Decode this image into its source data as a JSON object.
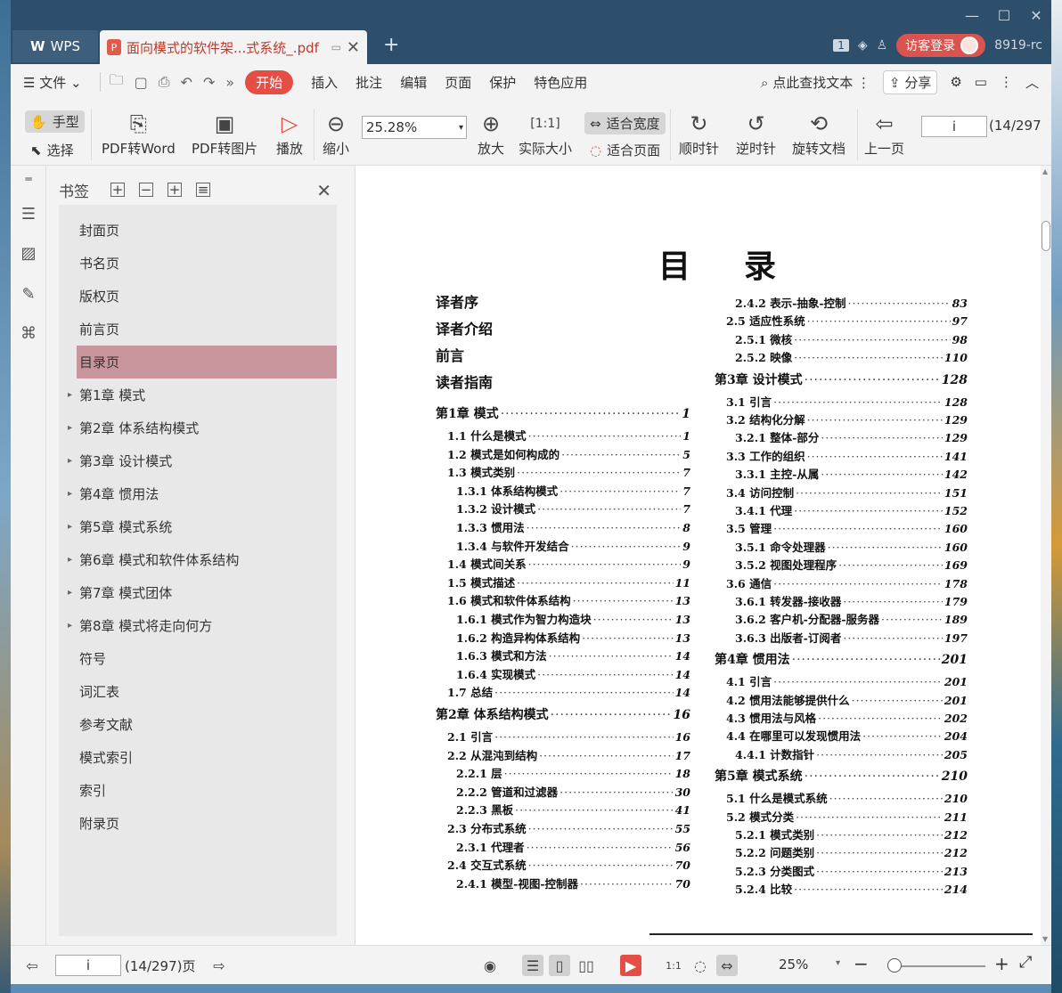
{
  "titlebar": {
    "wps_tab": "WPS",
    "doc_tab": "面向模式的软件架...式系统_.pdf",
    "user_button": "访客登录",
    "user_id": "8919-rc",
    "badge": "1"
  },
  "menubar": {
    "file": "文件",
    "items": [
      "开始",
      "插入",
      "批注",
      "编辑",
      "页面",
      "保护",
      "特色应用"
    ],
    "search": "点此查找文本",
    "share": "分享"
  },
  "ribbon": {
    "hand": "手型",
    "select": "选择",
    "pdf_word": "PDF转Word",
    "pdf_image": "PDF转图片",
    "play": "播放",
    "zoom_out": "缩小",
    "zoom_value": "25.28%",
    "zoom_in": "放大",
    "actual_size": "实际大小",
    "fit_width": "适合宽度",
    "fit_page": "适合页面",
    "clockwise": "顺时针",
    "counterclockwise": "逆时针",
    "rotate_doc": "旋转文档",
    "prev_page": "上一页",
    "page_value": "i",
    "page_total": "(14/297"
  },
  "bookmarks": {
    "title": "书签",
    "items": [
      {
        "label": "封面页",
        "expandable": false
      },
      {
        "label": "书名页",
        "expandable": false
      },
      {
        "label": "版权页",
        "expandable": false
      },
      {
        "label": "前言页",
        "expandable": false
      },
      {
        "label": "目录页",
        "expandable": false,
        "selected": true
      },
      {
        "label": "第1章  模式",
        "expandable": true
      },
      {
        "label": "第2章  体系结构模式",
        "expandable": true
      },
      {
        "label": "第3章  设计模式",
        "expandable": true
      },
      {
        "label": "第4章  惯用法",
        "expandable": true
      },
      {
        "label": "第5章  模式系统",
        "expandable": true
      },
      {
        "label": "第6章  模式和软件体系结构",
        "expandable": true
      },
      {
        "label": "第7章  模式团体",
        "expandable": true
      },
      {
        "label": "第8章  模式将走向何方",
        "expandable": true
      },
      {
        "label": "符号",
        "expandable": false
      },
      {
        "label": "词汇表",
        "expandable": false
      },
      {
        "label": "参考文献",
        "expandable": false
      },
      {
        "label": "模式索引",
        "expandable": false
      },
      {
        "label": "索引",
        "expandable": false
      },
      {
        "label": "附录页",
        "expandable": false
      }
    ]
  },
  "document": {
    "heading": "目录",
    "front_matter": [
      "译者序",
      "译者介绍",
      "前言",
      "读者指南"
    ],
    "left_column": [
      {
        "t": "第1章  模式",
        "p": "1",
        "level": 0
      },
      {
        "t": "1.1  什么是模式",
        "p": "1",
        "level": 1
      },
      {
        "t": "1.2  模式是如何构成的",
        "p": "5",
        "level": 1
      },
      {
        "t": "1.3  模式类别",
        "p": "7",
        "level": 1
      },
      {
        "t": "1.3.1  体系结构模式",
        "p": "7",
        "level": 2
      },
      {
        "t": "1.3.2  设计模式",
        "p": "7",
        "level": 2
      },
      {
        "t": "1.3.3  惯用法",
        "p": "8",
        "level": 2
      },
      {
        "t": "1.3.4  与软件开发结合",
        "p": "9",
        "level": 2
      },
      {
        "t": "1.4  模式间关系",
        "p": "9",
        "level": 1
      },
      {
        "t": "1.5  模式描述",
        "p": "11",
        "level": 1
      },
      {
        "t": "1.6  模式和软件体系结构",
        "p": "13",
        "level": 1
      },
      {
        "t": "1.6.1  模式作为智力构造块",
        "p": "13",
        "level": 2
      },
      {
        "t": "1.6.2  构造异构体系结构",
        "p": "13",
        "level": 2
      },
      {
        "t": "1.6.3  模式和方法",
        "p": "14",
        "level": 2
      },
      {
        "t": "1.6.4  实现模式",
        "p": "14",
        "level": 2
      },
      {
        "t": "1.7  总结",
        "p": "14",
        "level": 1
      },
      {
        "t": "第2章  体系结构模式",
        "p": "16",
        "level": 0
      },
      {
        "t": "2.1  引言",
        "p": "16",
        "level": 1
      },
      {
        "t": "2.2  从混沌到结构",
        "p": "17",
        "level": 1
      },
      {
        "t": "2.2.1  层",
        "p": "18",
        "level": 2
      },
      {
        "t": "2.2.2  管道和过滤器",
        "p": "30",
        "level": 2
      },
      {
        "t": "2.2.3  黑板",
        "p": "41",
        "level": 2
      },
      {
        "t": "2.3  分布式系统",
        "p": "55",
        "level": 1
      },
      {
        "t": "2.3.1  代理者",
        "p": "56",
        "level": 2
      },
      {
        "t": "2.4  交互式系统",
        "p": "70",
        "level": 1
      },
      {
        "t": "2.4.1  模型-视图-控制器",
        "p": "70",
        "level": 2
      }
    ],
    "right_column": [
      {
        "t": "2.4.2  表示-抽象-控制",
        "p": "83",
        "level": 2
      },
      {
        "t": "2.5  适应性系统",
        "p": "97",
        "level": 1
      },
      {
        "t": "2.5.1  微核",
        "p": "98",
        "level": 2
      },
      {
        "t": "2.5.2  映像",
        "p": "110",
        "level": 2
      },
      {
        "t": "第3章  设计模式",
        "p": "128",
        "level": 0
      },
      {
        "t": "3.1  引言",
        "p": "128",
        "level": 1
      },
      {
        "t": "3.2  结构化分解",
        "p": "129",
        "level": 1
      },
      {
        "t": "3.2.1  整体-部分",
        "p": "129",
        "level": 2
      },
      {
        "t": "3.3  工作的组织",
        "p": "141",
        "level": 1
      },
      {
        "t": "3.3.1  主控-从属",
        "p": "142",
        "level": 2
      },
      {
        "t": "3.4  访问控制",
        "p": "151",
        "level": 1
      },
      {
        "t": "3.4.1  代理",
        "p": "152",
        "level": 2
      },
      {
        "t": "3.5  管理",
        "p": "160",
        "level": 1
      },
      {
        "t": "3.5.1  命令处理器",
        "p": "160",
        "level": 2
      },
      {
        "t": "3.5.2  视图处理程序",
        "p": "169",
        "level": 2
      },
      {
        "t": "3.6  通信",
        "p": "178",
        "level": 1
      },
      {
        "t": "3.6.1  转发器-接收器",
        "p": "179",
        "level": 2
      },
      {
        "t": "3.6.2  客户机-分配器-服务器",
        "p": "189",
        "level": 2
      },
      {
        "t": "3.6.3  出版者-订阅者",
        "p": "197",
        "level": 2
      },
      {
        "t": "第4章  惯用法",
        "p": "201",
        "level": 0
      },
      {
        "t": "4.1  引言",
        "p": "201",
        "level": 1
      },
      {
        "t": "4.2  惯用法能够提供什么",
        "p": "201",
        "level": 1
      },
      {
        "t": "4.3  惯用法与风格",
        "p": "202",
        "level": 1
      },
      {
        "t": "4.4  在哪里可以发现惯用法",
        "p": "204",
        "level": 1
      },
      {
        "t": "4.4.1  计数指针",
        "p": "205",
        "level": 2
      },
      {
        "t": "第5章  模式系统",
        "p": "210",
        "level": 0
      },
      {
        "t": "5.1  什么是模式系统",
        "p": "210",
        "level": 1
      },
      {
        "t": "5.2  模式分类",
        "p": "211",
        "level": 1
      },
      {
        "t": "5.2.1  模式类别",
        "p": "212",
        "level": 2
      },
      {
        "t": "5.2.2  问题类别",
        "p": "212",
        "level": 2
      },
      {
        "t": "5.2.3  分类图式",
        "p": "213",
        "level": 2
      },
      {
        "t": "5.2.4  比较",
        "p": "214",
        "level": 2
      }
    ]
  },
  "statusbar": {
    "page_value": "i",
    "page_total": "(14/297)页",
    "zoom": "25%"
  }
}
